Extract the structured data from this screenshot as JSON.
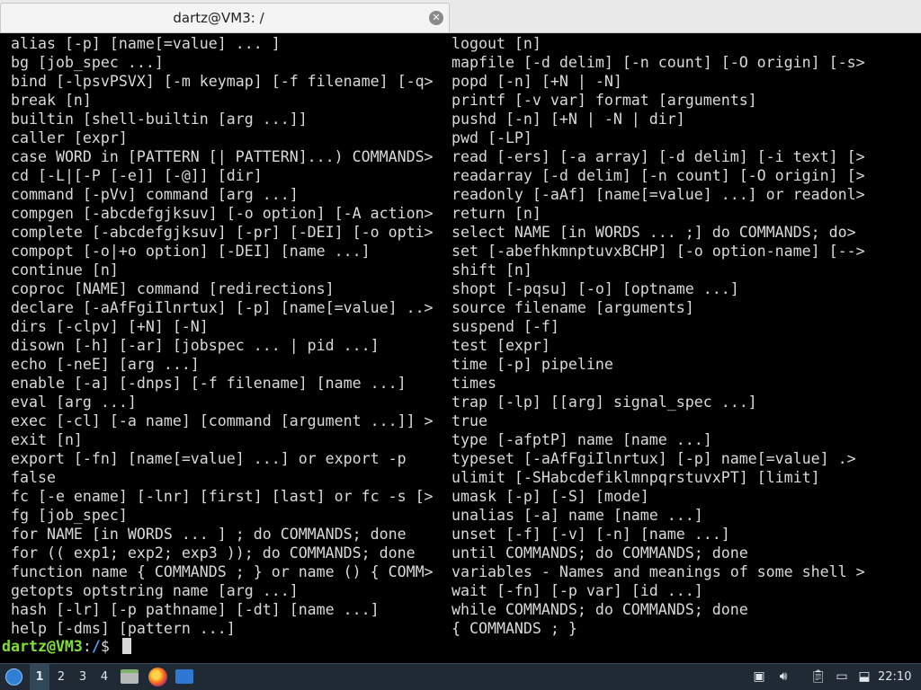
{
  "window": {
    "tab_title": "dartz@VM3: /",
    "tab_close_icon": "close-icon"
  },
  "terminal": {
    "left_column": [
      "alias [-p] [name[=value] ... ]",
      "bg [job_spec ...]",
      "bind [-lpsvPSVX] [-m keymap] [-f filename] [-q>",
      "break [n]",
      "builtin [shell-builtin [arg ...]]",
      "caller [expr]",
      "case WORD in [PATTERN [| PATTERN]...) COMMANDS>",
      "cd [-L|[-P [-e]] [-@]] [dir]",
      "command [-pVv] command [arg ...]",
      "compgen [-abcdefgjksuv] [-o option] [-A action>",
      "complete [-abcdefgjksuv] [-pr] [-DEI] [-o opti>",
      "compopt [-o|+o option] [-DEI] [name ...]",
      "continue [n]",
      "coproc [NAME] command [redirections]",
      "declare [-aAfFgiIlnrtux] [-p] [name[=value] ..>",
      "dirs [-clpv] [+N] [-N]",
      "disown [-h] [-ar] [jobspec ... | pid ...]",
      "echo [-neE] [arg ...]",
      "enable [-a] [-dnps] [-f filename] [name ...]",
      "eval [arg ...]",
      "exec [-cl] [-a name] [command [argument ...]] >",
      "exit [n]",
      "export [-fn] [name[=value] ...] or export -p",
      "false",
      "fc [-e ename] [-lnr] [first] [last] or fc -s [>",
      "fg [job_spec]",
      "for NAME [in WORDS ... ] ; do COMMANDS; done",
      "for (( exp1; exp2; exp3 )); do COMMANDS; done",
      "function name { COMMANDS ; } or name () { COMM>",
      "getopts optstring name [arg ...]",
      "hash [-lr] [-p pathname] [-dt] [name ...]",
      "help [-dms] [pattern ...]"
    ],
    "right_column": [
      "logout [n]",
      "mapfile [-d delim] [-n count] [-O origin] [-s>",
      "popd [-n] [+N | -N]",
      "printf [-v var] format [arguments]",
      "pushd [-n] [+N | -N | dir]",
      "pwd [-LP]",
      "read [-ers] [-a array] [-d delim] [-i text] [>",
      "readarray [-d delim] [-n count] [-O origin] [>",
      "readonly [-aAf] [name[=value] ...] or readonl>",
      "return [n]",
      "select NAME [in WORDS ... ;] do COMMANDS; do>",
      "set [-abefhkmnptuvxBCHP] [-o option-name] [-->",
      "shift [n]",
      "shopt [-pqsu] [-o] [optname ...]",
      "source filename [arguments]",
      "suspend [-f]",
      "test [expr]",
      "time [-p] pipeline",
      "times",
      "trap [-lp] [[arg] signal_spec ...]",
      "true",
      "type [-afptP] name [name ...]",
      "typeset [-aAfFgiIlnrtux] [-p] name[=value] .>",
      "ulimit [-SHabcdefiklmnpqrstuvxPT] [limit]",
      "umask [-p] [-S] [mode]",
      "unalias [-a] name [name ...]",
      "unset [-f] [-v] [-n] [name ...]",
      "until COMMANDS; do COMMANDS; done",
      "variables - Names and meanings of some shell >",
      "wait [-fn] [-p var] [id ...]",
      "while COMMANDS; do COMMANDS; done",
      "{ COMMANDS ; }"
    ],
    "prompt": {
      "user_host": "dartz@VM3",
      "separator": ":",
      "path": "/",
      "symbol": "$ "
    },
    "colors": {
      "background": "#000000",
      "text": "#d9d9d9",
      "prompt_user": "#7fe036",
      "prompt_path": "#4aa0ff"
    }
  },
  "taskbar": {
    "menu_icon": "whisker-menu-icon",
    "workspaces": [
      "1",
      "2",
      "3",
      "4"
    ],
    "active_workspace": "1",
    "launchers": [
      "file-manager-icon",
      "firefox-icon",
      "window-icon"
    ],
    "tray_icons": [
      "notification-icon",
      "volume-icon",
      "clipboard-icon",
      "network-icon",
      "update-icon"
    ],
    "clock": "22:10"
  }
}
